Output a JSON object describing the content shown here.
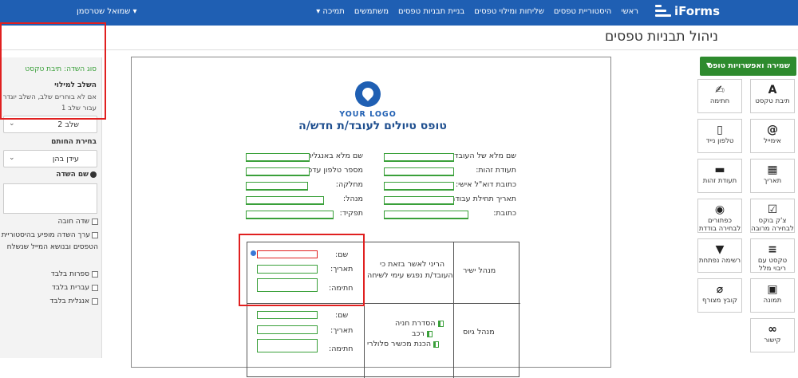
{
  "topnav": {
    "brand": "iForms",
    "links": [
      "ראשי",
      "היסטוריית טפסים",
      "שליחות ומילוי טפסים",
      "בניית תבניות טפסים",
      "משתמשים",
      "תמיכה ▾"
    ],
    "user": "▾ שמואל שטרסמן"
  },
  "page": {
    "title": "ניהול תבניות טפסים"
  },
  "left_panel": {
    "field_type": "סוג השדה: תיבת טקסט",
    "stage_heading": "השלב למילוי",
    "stage_note1": "אם לא בוחרים שלב, השלב יוגדר",
    "stage_note2": "עבור שלב 1",
    "stage_value": "שלב 2",
    "signer_heading": "בחירת החותם",
    "signer_value": "עידן בהן",
    "field_name_label": "שם השדה",
    "checks": {
      "required": "שדה חובה",
      "history": "ערך השדה מופיע בהיסטוריית הטפסים ובנושא המייל שנשלח",
      "digits_only": "ספרות בלבד",
      "hebrew_only": "עברית בלבד",
      "english_only": "אנגלית בלבד"
    }
  },
  "form": {
    "logo_text": "YOUR LOGO",
    "title": "טופס טיולים לעובד/ת חדש/ה",
    "right_fields": [
      "שם מלא של העובד:",
      "תעודת זהות:",
      "כתובת דוא\"ל אישי:",
      "תאריך תחילת עבודה:",
      "כתובת:"
    ],
    "left_fields": [
      "שם מלא באנגלית:",
      "מספר טלפון עדכני:",
      "מחלקה:",
      "מנהל:",
      "תפקיד:"
    ],
    "table": {
      "row1_role": "מנהל ישיר",
      "row1_text1": "הריני לאשר בזאת כי",
      "row1_text2": "העובד/ת נפגש עימי לשיחה",
      "row2_role": "מנהל גיוס",
      "row2_items": [
        "הסדרת חניה",
        "רכב",
        "הכנת מכשיר סלולרי"
      ],
      "sig_name": "שם:",
      "sig_date": "תאריך:",
      "sig_sign": "חתימה:"
    }
  },
  "toolbox": {
    "save_label": "שמירה ואפשרויות טופס",
    "tools": [
      {
        "label": "תיבת טקסט",
        "icon": "text-icon",
        "glyph": "A"
      },
      {
        "label": "חתימה",
        "icon": "signature-icon",
        "glyph": "✍"
      },
      {
        "label": "אימייל",
        "icon": "at-icon",
        "glyph": "@"
      },
      {
        "label": "טלפון נייד",
        "icon": "phone-icon",
        "glyph": "▯"
      },
      {
        "label": "תאריך",
        "icon": "calendar-icon",
        "glyph": "▦"
      },
      {
        "label": "תעודת זהות",
        "icon": "id-card-icon",
        "glyph": "▬"
      },
      {
        "label": "צ'ק בוקס לבחירה מרובה",
        "icon": "checkbox-icon",
        "glyph": "☑"
      },
      {
        "label": "כפתורים לבחירה בודדת",
        "icon": "radio-icon",
        "glyph": "◉"
      },
      {
        "label": "טקסט עם ריבוי מלל",
        "icon": "multiline-icon",
        "glyph": "≡"
      },
      {
        "label": "רשימה נפתחת",
        "icon": "dropdown-icon",
        "glyph": "▼"
      },
      {
        "label": "תמונה",
        "icon": "image-icon",
        "glyph": "▣"
      },
      {
        "label": "קובץ מצורף",
        "icon": "paperclip-icon",
        "glyph": "⌀"
      },
      {
        "label": "קישור",
        "icon": "link-icon",
        "glyph": "∞"
      }
    ]
  }
}
